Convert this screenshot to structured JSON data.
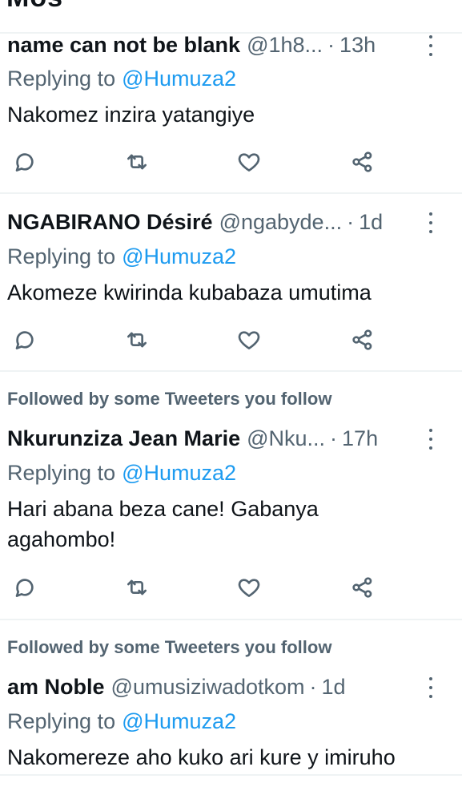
{
  "top_partial_title": "Mos",
  "tweets": [
    {
      "social_context": "",
      "name": "name can not be blank",
      "handle": "@1h8...",
      "dot": "·",
      "time": "13h",
      "replying_prefix": "Replying to",
      "replying_to": "@Humuza2",
      "text": "Nakomez inzira yatangiye"
    },
    {
      "social_context": "",
      "name": "NGABIRANO Désiré",
      "handle": "@ngabyde...",
      "dot": "·",
      "time": "1d",
      "replying_prefix": "Replying to",
      "replying_to": "@Humuza2",
      "text": "Akomeze kwirinda kubabaza umutima"
    },
    {
      "social_context": "Followed by some Tweeters you follow",
      "name": "Nkurunziza Jean Marie",
      "handle": "@Nku...",
      "dot": "·",
      "time": "17h",
      "replying_prefix": "Replying to",
      "replying_to": "@Humuza2",
      "text": "Hari abana beza cane! Gabanya agahombo!"
    },
    {
      "social_context": "Followed by some Tweeters you follow",
      "name": "am Noble",
      "handle": "@umusiziwadotkom",
      "dot": "·",
      "time": "1d",
      "replying_prefix": "Replying to",
      "replying_to": "@Humuza2",
      "text": "Nakomereze aho kuko ari kure y imiruho"
    }
  ],
  "icons": {
    "reply": "reply-icon",
    "retweet": "retweet-icon",
    "like": "heart-icon",
    "share": "share-icon",
    "more": "more-vertical-icon"
  },
  "colors": {
    "text": "#0f1419",
    "secondary": "#536471",
    "accent": "#1d9bf0",
    "divider": "#eff3f4"
  }
}
